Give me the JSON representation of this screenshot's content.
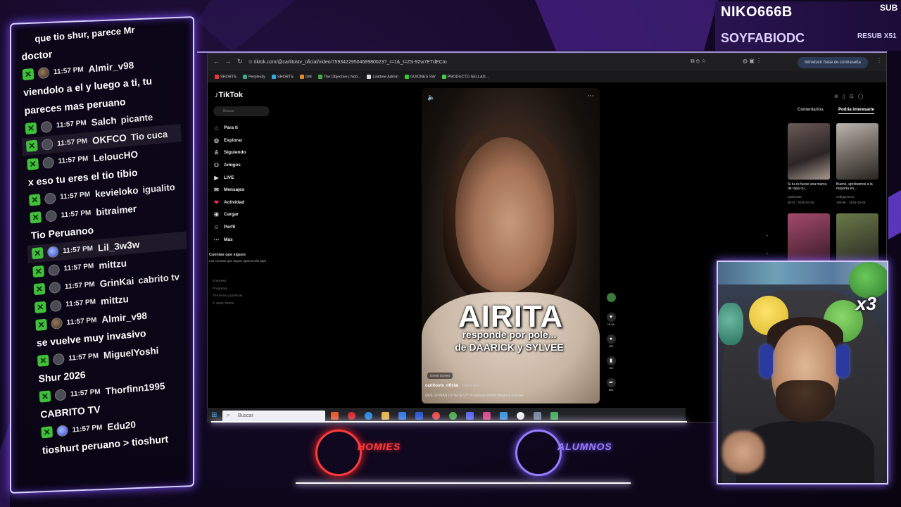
{
  "subs": {
    "top_name": "NIKO666B",
    "top_tag": "SUB",
    "second_name": "SOYFABIODC",
    "second_tag": "RESUB X51"
  },
  "chat": {
    "entries": [
      {
        "kind": "text",
        "text": "doctor"
      },
      {
        "kind": "msg",
        "avatar": "avatar-photo",
        "time": "11:57 PM",
        "user": "Almir_v98",
        "message": ""
      },
      {
        "kind": "text",
        "text": "viendolo a el y luego a ti, tu"
      },
      {
        "kind": "text",
        "text": "pareces mas peruano"
      },
      {
        "kind": "msg",
        "avatar": "person-icon",
        "time": "11:57 PM",
        "user": "Salch",
        "message": "picante"
      },
      {
        "kind": "msg",
        "avatar": "person-icon",
        "time": "11:57 PM",
        "user": "OKFCO",
        "message": "Tio cuca",
        "highlight": true
      },
      {
        "kind": "msg",
        "avatar": "person-icon",
        "time": "11:57 PM",
        "user": "LeloucHO",
        "message": ""
      },
      {
        "kind": "text",
        "text": "x eso tu eres el tio tibio"
      },
      {
        "kind": "msg",
        "avatar": "person-icon",
        "time": "11:57 PM",
        "user": "kevieloko",
        "message": "igualito"
      },
      {
        "kind": "msg",
        "avatar": "person-icon",
        "time": "11:57 PM",
        "user": "bitraimer",
        "message": ""
      },
      {
        "kind": "text",
        "text": "Tio Peruanoo"
      },
      {
        "kind": "msg",
        "avatar": "avatar-blue",
        "time": "11:57 PM",
        "user": "Lil_3w3w",
        "message": "",
        "highlight": true
      },
      {
        "kind": "msg",
        "avatar": "rocket-icon",
        "time": "11:57 PM",
        "user": "mittzu",
        "message": ""
      },
      {
        "kind": "msg",
        "avatar": "person-icon",
        "time": "11:57 PM",
        "user": "GrinKai",
        "message": "cabrito tv"
      },
      {
        "kind": "msg",
        "avatar": "rocket-icon",
        "time": "11:57 PM",
        "user": "mittzu",
        "message": ""
      },
      {
        "kind": "msg",
        "avatar": "avatar-photo",
        "time": "11:57 PM",
        "user": "Almir_v98",
        "message": ""
      },
      {
        "kind": "text",
        "text": "se vuelve muy invasivo"
      },
      {
        "kind": "msg",
        "avatar": "person-icon",
        "time": "11:57 PM",
        "user": "MiguelYoshi",
        "message": ""
      },
      {
        "kind": "text",
        "text": "Shur 2026"
      },
      {
        "kind": "msg",
        "avatar": "person-icon",
        "time": "11:57 PM",
        "user": "Thorfinn1995",
        "message": ""
      },
      {
        "kind": "text",
        "text": "CABRITO TV"
      },
      {
        "kind": "msg",
        "avatar": "avatar-blue",
        "time": "11:57 PM",
        "user": "Edu20",
        "message": ""
      },
      {
        "kind": "text",
        "text": "tioshurt peruano > tioshurt"
      }
    ],
    "top_fragment": "que tio shur, parece Mr"
  },
  "browser": {
    "url": "tiktok.com/@carlitostv_oficial/video/7593422950468980023?_r=1&_t=ZS-92w7ETdECto",
    "password_pill": "Introducir frase de contraseña",
    "bookmarks": [
      "SHORTS",
      "Perplexity",
      "SHORTS",
      "GM",
      "The Objective | Noti...",
      "Linktree Admin",
      "GUIONES SW",
      "PRODUCTO SELLAD..."
    ]
  },
  "tiktok": {
    "logo": "TikTok",
    "search_placeholder": "Buscar",
    "nav": [
      {
        "icon": "home-icon",
        "label": "Para ti"
      },
      {
        "icon": "compass-icon",
        "label": "Explorar"
      },
      {
        "icon": "following-icon",
        "label": "Siguiendo"
      },
      {
        "icon": "friends-icon",
        "label": "Amigos"
      },
      {
        "icon": "live-icon",
        "label": "LIVE"
      },
      {
        "icon": "messages-icon",
        "label": "Mensajes"
      },
      {
        "icon": "activity-icon",
        "label": "Actividad"
      },
      {
        "icon": "upload-icon",
        "label": "Cargar"
      },
      {
        "icon": "profile-icon",
        "label": "Perfil"
      },
      {
        "icon": "more-icon",
        "label": "Más"
      }
    ],
    "following_title": "Cuentas que sigues",
    "following_sub": "Las cuentas que sigues aparecerán aquí",
    "footer": [
      "Empresa",
      "Programa",
      "Términos y políticas",
      "© 2026 TikTok"
    ],
    "video": {
      "title": "AIRITA",
      "subtitle1": "responde por pole...",
      "subtitle2": "de DAARICK y SYLVEE",
      "badge": "Green Screen",
      "author": "carlitostv_oficial",
      "when": "· Hace 4 h",
      "caption": "QUE OPINAN USTEDES?? #carlitostv #airita #daarick #sylvee",
      "counts": {
        "likes": "18.5K",
        "comments": "299",
        "saves": "769",
        "shares": "806"
      }
    },
    "right_panel": {
      "tab1": "Comentarios",
      "tab2": "Podría interesarte",
      "thumbs": [
        {
          "caption": "Si tu ex fuese una marca de ropa cu...",
          "user": "jowkeclub",
          "meta": "6673 · 2025-10-28"
        },
        {
          "caption": "Bueno, aprobamos a la mayoría en...",
          "user": "codigonuevo",
          "meta": "109.8K · 2025-10-28"
        }
      ]
    }
  },
  "taskbar": {
    "search_placeholder": "Buscar"
  },
  "overlay": {
    "logo_left": "HOMIES",
    "logo_right": "ALUMNOS",
    "multiplier": "x3"
  },
  "colors": {
    "accent_purple": "#8a62ff",
    "homies_red": "#ff3b3b",
    "chat_badge_green": "#3fbf3a",
    "tiktok_pink": "#fe2c55"
  }
}
